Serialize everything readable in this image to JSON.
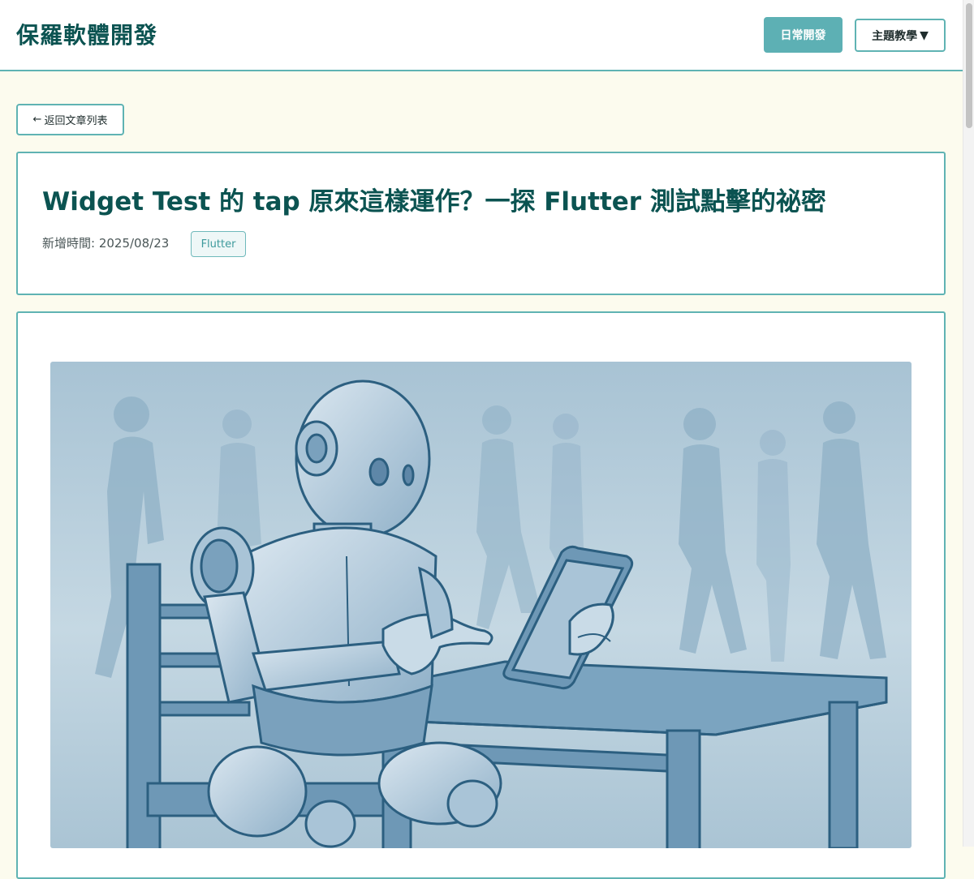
{
  "site": {
    "title": "保羅軟體開發"
  },
  "nav": {
    "primary_label": "日常開發",
    "dropdown_label": "主題教學",
    "dropdown_icon": "▼"
  },
  "back_button": {
    "arrow": "←",
    "label": "返回文章列表"
  },
  "article": {
    "title": "Widget Test 的 tap 原來這樣運作？一探 Flutter 測試點擊的祕密",
    "date": "新增時間: 2025/08/23",
    "tag": "Flutter"
  },
  "hero_image": {
    "subject": "robot-using-tablet-illustration"
  },
  "colors": {
    "accent": "#5fb3b3",
    "title": "#0b5351",
    "page_bg": "#fcfbee",
    "primary_button": "#5db0b4"
  }
}
